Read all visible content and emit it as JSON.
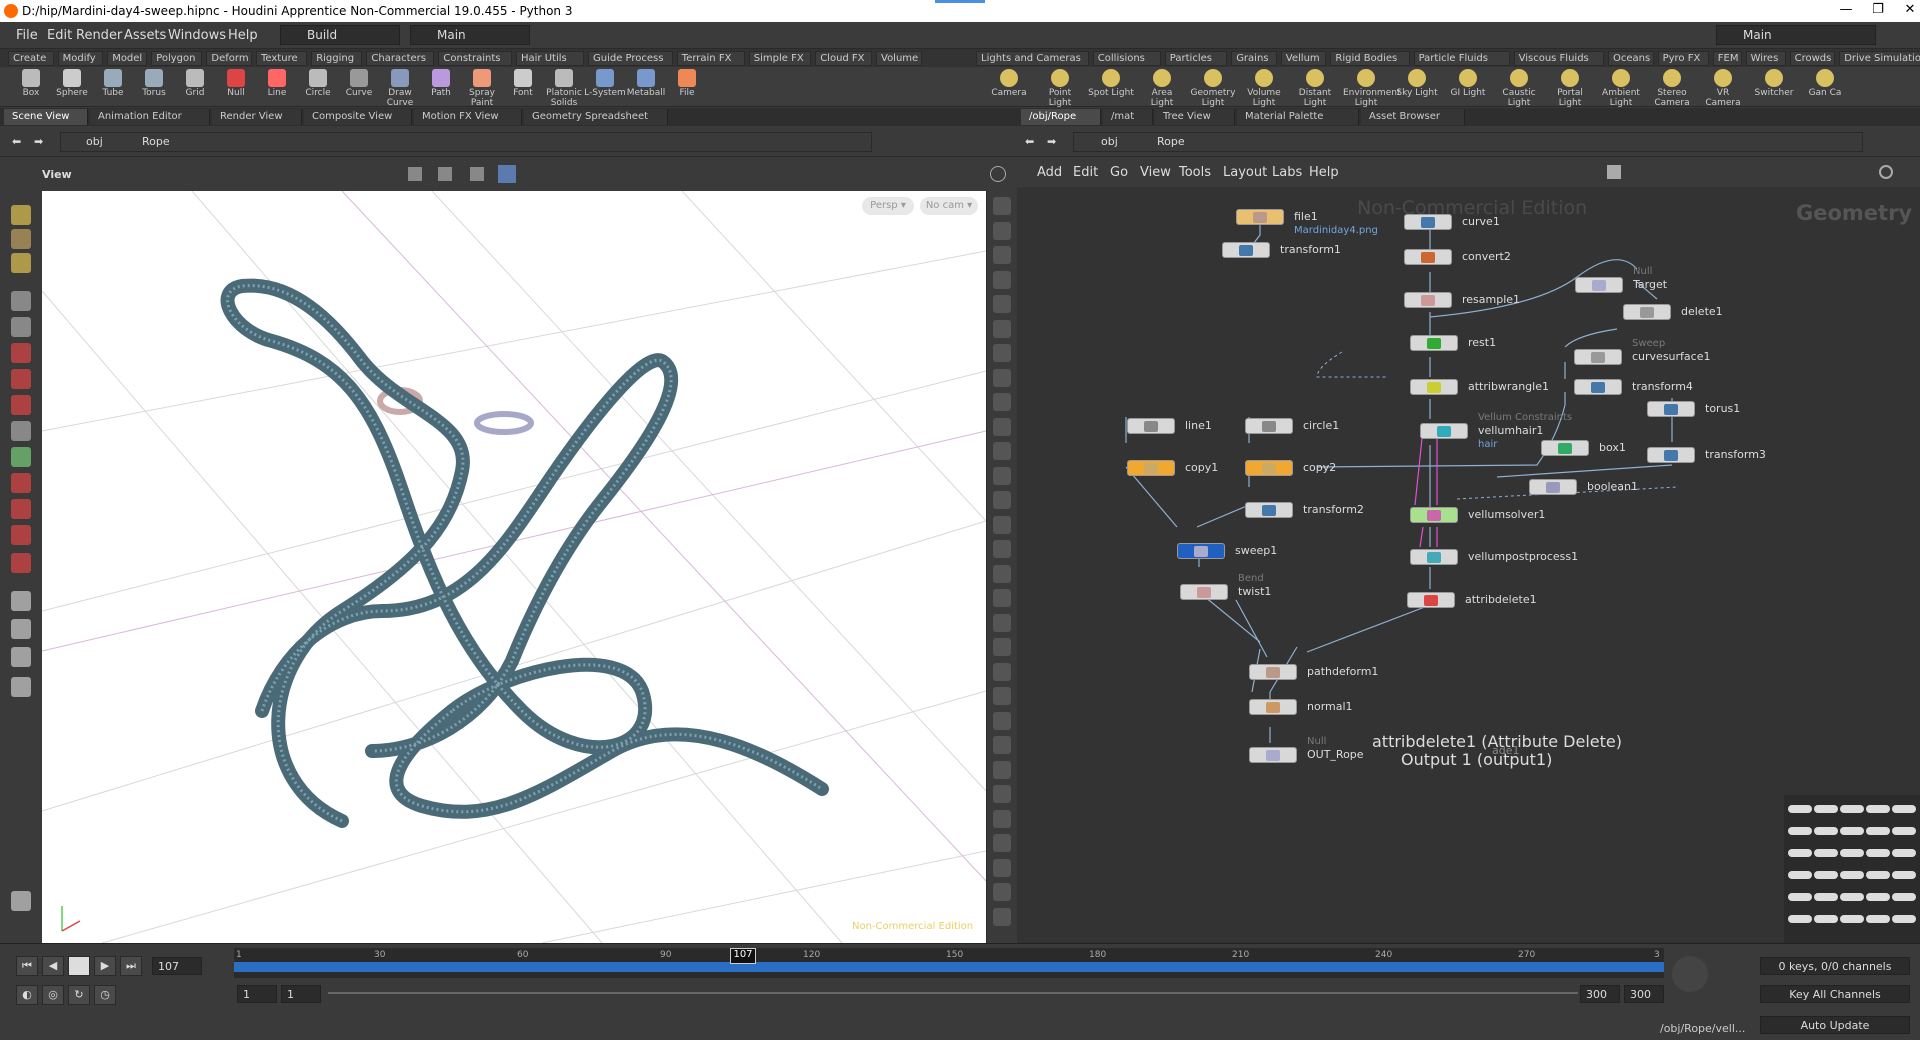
{
  "titlebar": {
    "title": "D:/hip/Mardini-day4-sweep.hipnc - Houdini Apprentice Non-Commercial 19.0.455 - Python 3",
    "minimize": "—",
    "maximize": "❐",
    "close": "✕"
  },
  "menubar": {
    "items": [
      "File",
      "Edit",
      "Render",
      "Assets",
      "Windows",
      "Help"
    ],
    "desktop": "Build",
    "layout": "Main",
    "right_layout": "Main"
  },
  "shelf_tabs_left": [
    "Create",
    "Modify",
    "Model",
    "Polygon",
    "Deform",
    "Texture",
    "Rigging",
    "Characters",
    "Constraints",
    "Hair Utils",
    "Guide Process",
    "Terrain FX",
    "Simple FX",
    "Cloud FX",
    "Volume"
  ],
  "shelf_tabs_right": [
    "Lights and Cameras",
    "Collisions",
    "Particles",
    "Grains",
    "Vellum",
    "Rigid Bodies",
    "Particle Fluids",
    "Viscous Fluids",
    "Oceans",
    "Pyro FX",
    "FEM",
    "Wires",
    "Crowds",
    "Drive Simulation"
  ],
  "tools_left": [
    "Box",
    "Sphere",
    "Tube",
    "Torus",
    "Grid",
    "Null",
    "Line",
    "Circle",
    "Curve",
    "Draw Curve",
    "Path",
    "Spray Paint",
    "Font",
    "Platonic Solids",
    "L-System",
    "Metaball",
    "File"
  ],
  "tools_right": [
    "Camera",
    "Point Light",
    "Spot Light",
    "Area Light",
    "Geometry Light",
    "Volume Light",
    "Distant Light",
    "Environment Light",
    "Sky Light",
    "GI Light",
    "Caustic Light",
    "Portal Light",
    "Ambient Light",
    "Stereo Camera",
    "VR Camera",
    "Switcher",
    "Gan Ca"
  ],
  "pane_tabs_left": [
    "Scene View",
    "Animation Editor",
    "Render View",
    "Composite View",
    "Motion FX View",
    "Geometry Spreadsheet"
  ],
  "pane_tabs_right": [
    "/obj/Rope",
    "/mat",
    "Tree View",
    "Material Palette",
    "Asset Browser"
  ],
  "path_left": {
    "root": "obj",
    "node": "Rope"
  },
  "path_right": {
    "root": "obj",
    "node": "Rope"
  },
  "viewport": {
    "title": "View",
    "persp": "Persp ▾",
    "cam": "No cam ▾",
    "watermark": "Non-Commercial Edition"
  },
  "network_menu": [
    "Add",
    "Edit",
    "Go",
    "View",
    "Tools",
    "Layout",
    "Labs",
    "Help"
  ],
  "network": {
    "watermark": "Non-Commercial Edition",
    "context": "Geometry",
    "nodes": {
      "file1": "file1",
      "file1_sub": "Mardiniday4.png",
      "transform1": "transform1",
      "curve1": "curve1",
      "convert2": "convert2",
      "resample1": "resample1",
      "rest1": "rest1",
      "attribwrangle1": "attribwrangle1",
      "vellumhair1": "vellumhair1",
      "vellumhair1_type": "Vellum Constraints",
      "vellumhair1_sub": "hair",
      "vellumsolver1": "vellumsolver1",
      "vellumpostprocess1": "vellumpostprocess1",
      "attribdelete1": "attribdelete1",
      "line1": "line1",
      "copy1": "copy1",
      "circle1": "circle1",
      "copy2": "copy2",
      "transform2": "transform2",
      "sweep1": "sweep1",
      "twist1": "twist1",
      "twist1_type": "Bend",
      "pathdeform1": "pathdeform1",
      "normal1": "normal1",
      "out_rope": "OUT_Rope",
      "out_rope_type": "Null",
      "target": "Target",
      "target_type": "Null",
      "delete1": "delete1",
      "curvesurface1": "curvesurface1",
      "curvesurface1_type": "Sweep",
      "transform4": "transform4",
      "torus1": "torus1",
      "transform3": "transform3",
      "box1": "box1",
      "boolean1": "boolean1"
    },
    "tooltip_title": "attribdelete1 (Attribute Delete)",
    "tooltip_sub": "Output 1 (output1)",
    "ghost_label": "ade1"
  },
  "timeline": {
    "frame": "107",
    "ticks": [
      "1",
      "30",
      "60",
      "90",
      "120",
      "150",
      "180",
      "210",
      "240",
      "270",
      "3"
    ],
    "start": "1",
    "start2": "1",
    "end": "300",
    "end2": "300",
    "marker": "107",
    "keys": "0 keys, 0/0 channels",
    "key_all": "Key All Channels",
    "status_path": "/obj/Rope/vell...",
    "auto_update": "Auto Update"
  }
}
